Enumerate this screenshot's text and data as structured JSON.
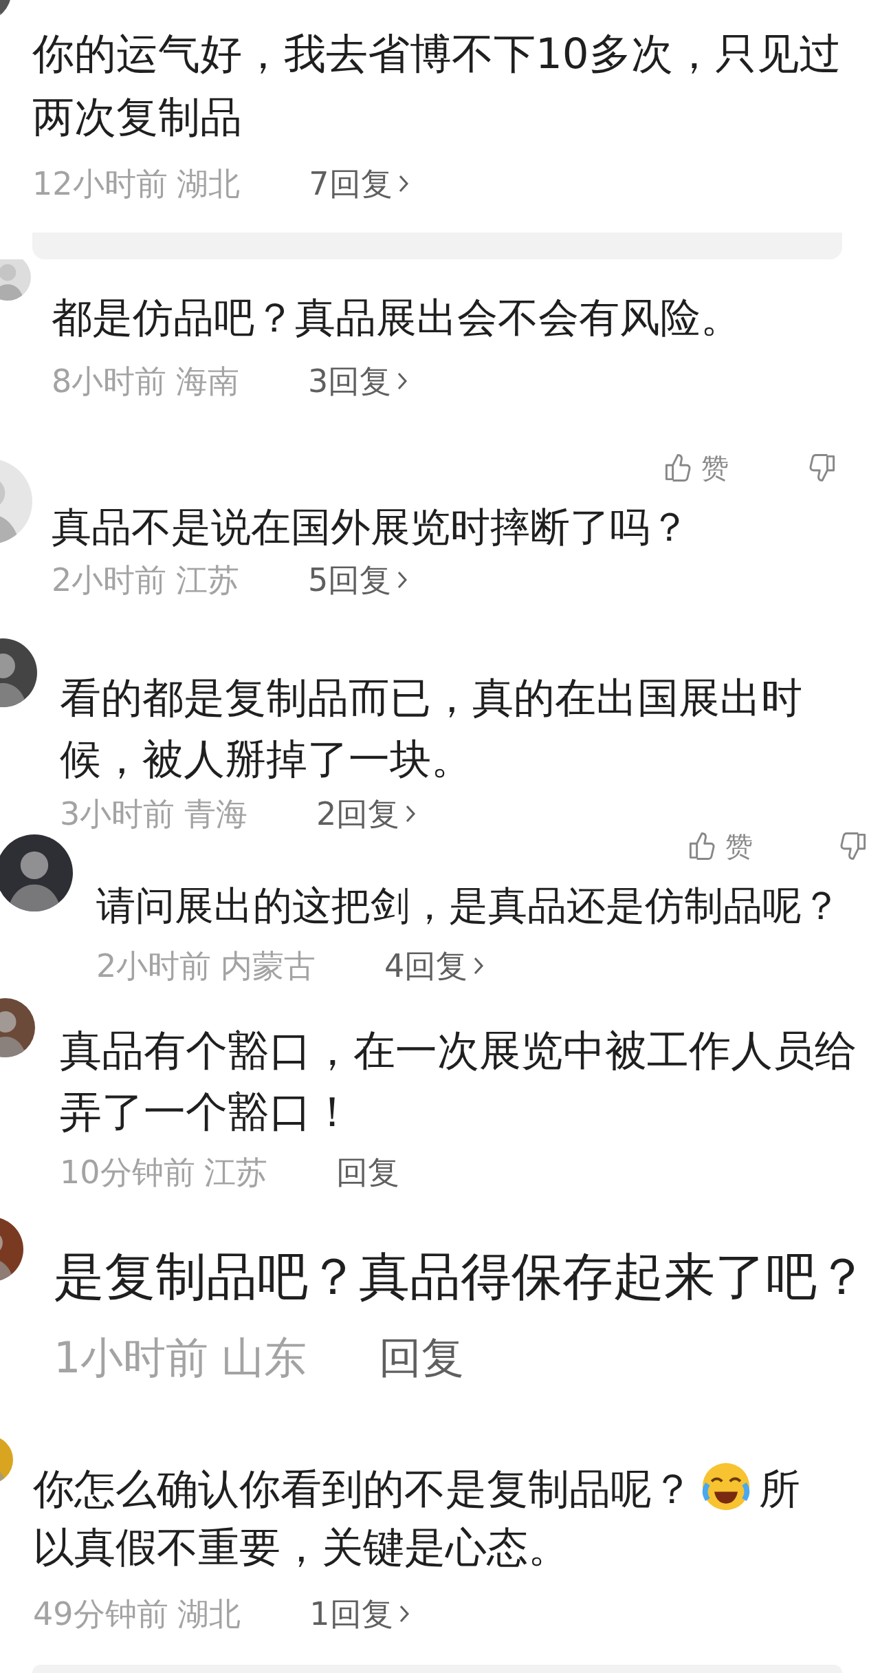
{
  "comments": [
    {
      "text": "你的运气好，我去省博不下10多次，只见过两次复制品",
      "time": "12小时前",
      "location": "湖北",
      "replies": "7回复",
      "arrow": true
    },
    {
      "text": "都是仿品吧？真品展出会不会有风险。",
      "time": "8小时前",
      "location": "海南",
      "replies": "3回复",
      "arrow": true
    },
    {
      "header": {
        "like_label": "赞"
      },
      "text": "真品不是说在国外展览时摔断了吗？",
      "time": "2小时前",
      "location": "江苏",
      "replies": "5回复",
      "arrow": true
    },
    {
      "text": "看的都是复制品而已，真的在出国展出时候，被人掰掉了一块。",
      "time": "3小时前",
      "location": "青海",
      "replies": "2回复",
      "arrow": true
    },
    {
      "header": {
        "like_label": "赞"
      },
      "text": "请问展出的这把剑，是真品还是仿制品呢？",
      "time": "2小时前",
      "location": "内蒙古",
      "replies": "4回复",
      "arrow": true
    },
    {
      "text": "真品有个豁口，在一次展览中被工作人员给弄了一个豁口！",
      "time": "10分钟前",
      "location": "江苏",
      "replies": "回复",
      "arrow": false
    },
    {
      "text": "是复制品吧？真品得保存起来了吧？",
      "time": "1小时前",
      "location": "山东",
      "replies": "回复",
      "arrow": false
    },
    {
      "text_parts": [
        {
          "kind": "text",
          "text": "你怎么确认你看到的不是复制品呢？"
        },
        {
          "kind": "emoji"
        },
        {
          "kind": "text",
          "text": "所"
        },
        {
          "kind": "break"
        },
        {
          "kind": "text",
          "text": "以真假不重要，关键是心态。"
        }
      ],
      "time": "49分钟前",
      "location": "湖北",
      "replies": "1回复",
      "arrow": true
    }
  ]
}
